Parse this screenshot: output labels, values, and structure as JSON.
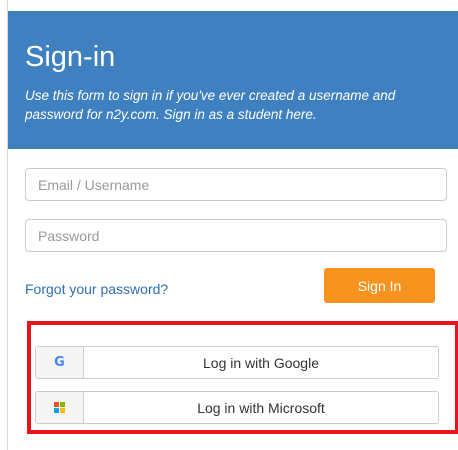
{
  "header": {
    "title": "Sign-in",
    "subtitle": "Use this form to sign in if you've ever created a username and password for n2y.com. Sign in as a student here."
  },
  "form": {
    "email_placeholder": "Email / Username",
    "password_placeholder": "Password",
    "forgot_label": "Forgot your password?",
    "signin_label": "Sign In"
  },
  "sso": {
    "google_label": "Log in with Google",
    "google_icon_letter": "G",
    "google_icon": "google-g-icon",
    "microsoft_label": "Log in with Microsoft",
    "microsoft_icon": "microsoft-logo-icon"
  },
  "colors": {
    "header_bg": "#3f80c0",
    "signin_button": "#f7931e",
    "highlight_border": "#e8141b",
    "link": "#2f70b0"
  }
}
